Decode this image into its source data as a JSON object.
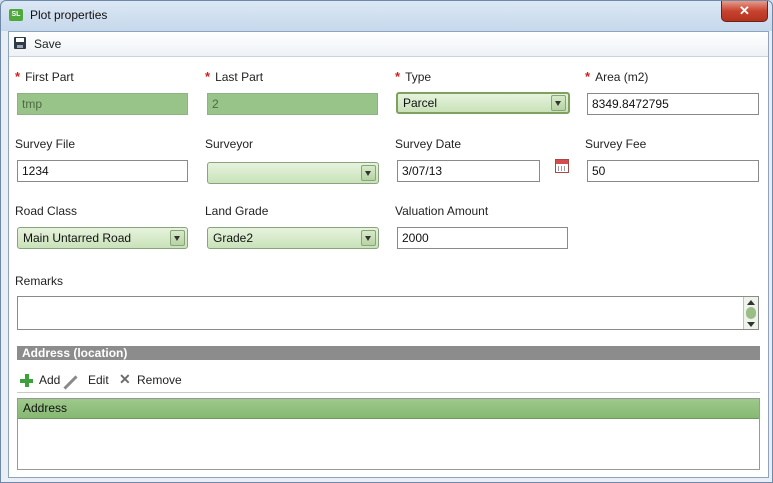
{
  "window": {
    "title": "Plot properties",
    "close_label": "✕",
    "app_icon_text": "SL"
  },
  "toolbar": {
    "save_label": "Save"
  },
  "form": {
    "required_marker": "*",
    "first_part": {
      "label": "First Part",
      "value": "tmp"
    },
    "last_part": {
      "label": "Last Part",
      "value": "2"
    },
    "type": {
      "label": "Type",
      "value": "Parcel"
    },
    "area": {
      "label": "Area (m2)",
      "value": "8349.8472795"
    },
    "survey_file": {
      "label": "Survey File",
      "value": "1234"
    },
    "surveyor": {
      "label": "Surveyor",
      "value": ""
    },
    "survey_date": {
      "label": "Survey Date",
      "value": "3/07/13"
    },
    "survey_fee": {
      "label": "Survey Fee",
      "value": "50"
    },
    "road_class": {
      "label": "Road Class",
      "value": "Main Untarred Road"
    },
    "land_grade": {
      "label": "Land Grade",
      "value": "Grade2"
    },
    "valuation_amount": {
      "label": "Valuation Amount",
      "value": "2000"
    },
    "remarks": {
      "label": "Remarks",
      "value": ""
    }
  },
  "address_section": {
    "title": "Address (location)",
    "actions": {
      "add": "Add",
      "edit": "Edit",
      "remove": "Remove"
    },
    "columns": [
      "Address"
    ],
    "rows": []
  }
}
